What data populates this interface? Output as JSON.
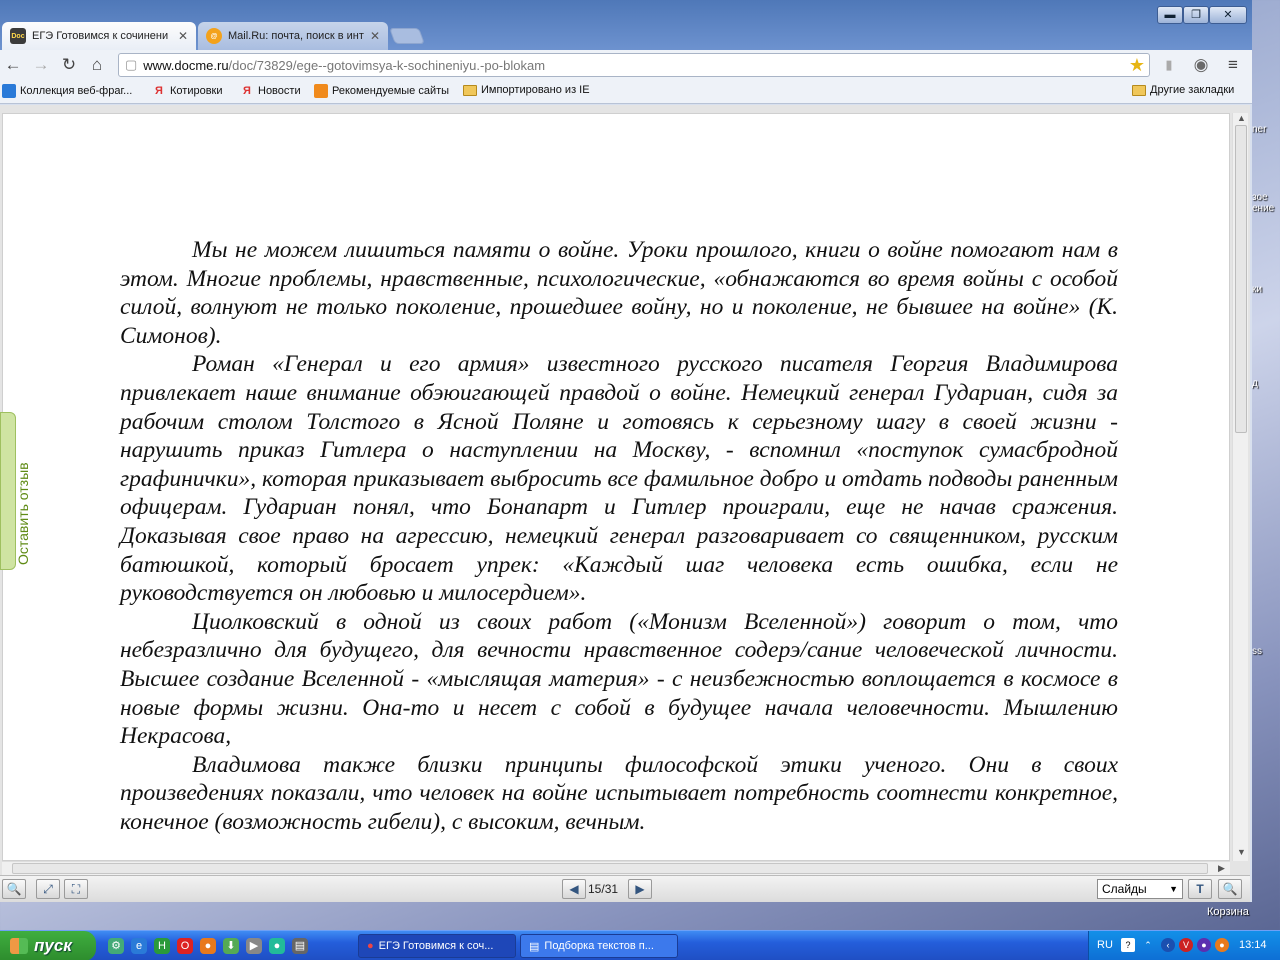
{
  "browser": {
    "tabs": [
      {
        "title": "ЕГЭ Готовимся к сочинени",
        "favicon_text": "Doc Me"
      },
      {
        "title": "Mail.Ru: почта, поиск в инт",
        "favicon_text": "@"
      }
    ],
    "address": {
      "host": "www.docme.ru",
      "path": "/doc/73829/ege--gotovimsya-k-sochineniyu.-po-blokam"
    },
    "bookmarks": [
      "Коллекция веб-фраг...",
      "Котировки",
      "Новости",
      "Рекомендуемые сайты",
      "Импортировано из IE"
    ],
    "other_bookmarks": "Другие закладки"
  },
  "document": {
    "paragraphs": [
      "Мы не можем лишиться памяти о войне. Уроки прошлого, книги о войне помогают нам в этом. Многие проблемы, нравственные, психологические, «обнажаются во время войны с особой силой, волнуют не только поколение, прошедшее войну, но и поколение, не бывшее на войне» (К. Симонов).",
      "Роман «Генерал и его армия» известного русского писателя Георгия Владимирова привлекает наше внимание обэюигающей правдой о войне. Немецкий генерал Гудариан, сидя за рабочим столом Толстого в Ясной Поляне и готовясь к серьезному шагу в своей жизни - нарушить приказ Гитлера о наступлении на Москву, - вспомнил «поступок сумасбродной графинички», которая приказывает выбросить все фамильное добро и отдать подводы раненным офицерам. Гудариан понял, что Бонапарт и Гитлер проиграли, еще не начав сражения. Доказывая свое право на агрессию, немецкий генерал разговаривает со священником, русским батюшкой, который бросает упрек: «Каждый шаг человека есть ошибка, если не руководствуется он любовью и милосердием».",
      "Циолковский в одной из своих работ («Монизм Вселенной») говорит о том, что небезразлично для будущего, для вечности нравственное содерэ/сание человеческой личности. Высшее создание Вселенной - «мыслящая материя» - с неизбежностью воплощается в космосе в новые формы жизни. Она-то и несет с собой в будущее начала человечности. Мышлению Некрасова,",
      "Владимова также близки принципы философской этики ученого. Они в своих произведениях показали, что человек на войне испытывает потребность соотнести конкретное, конечное (возможность гибели), с высоким, вечным."
    ]
  },
  "viewer": {
    "feedback_label": "Оставить отзыв",
    "page_current": "15",
    "page_total": "31",
    "view_mode": "Слайды"
  },
  "desktop": {
    "trash_label": "Корзина",
    "edge_labels": [
      "ner",
      "зое\nение",
      "ки",
      "д",
      "ss"
    ]
  },
  "taskbar": {
    "start_label": "пуск",
    "tasks": [
      "ЕГЭ Готовимся к соч...",
      "Подборка текстов п..."
    ],
    "language": "RU",
    "clock": "13:14"
  },
  "colors": {
    "accent_orange": "#e0862a",
    "feedback_green": "#5f8b15",
    "taskbar_blue": "#245edb"
  }
}
